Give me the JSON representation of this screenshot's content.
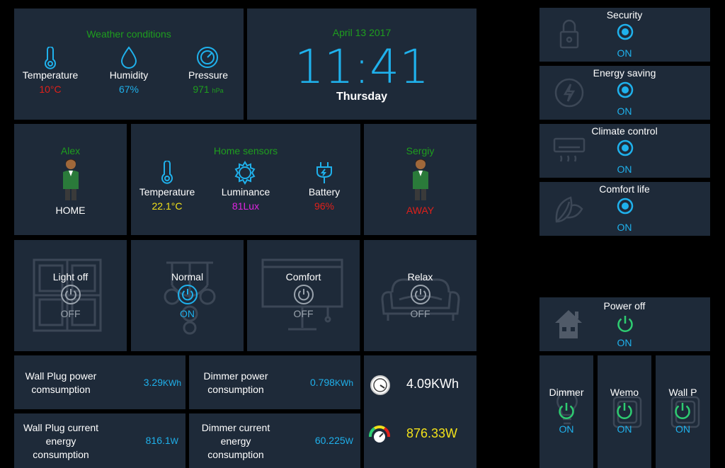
{
  "weather": {
    "title": "Weather conditions",
    "temperature": {
      "label": "Temperature",
      "value": "10°C"
    },
    "humidity": {
      "label": "Humidity",
      "value": "67%"
    },
    "pressure": {
      "label": "Pressure",
      "value": "971",
      "unit": "hPa"
    }
  },
  "clock": {
    "date": "April 13 2017",
    "time": "11:41",
    "day": "Thursday"
  },
  "persons": [
    {
      "name": "Alex",
      "status": "HOME"
    },
    {
      "name": "Sergiy",
      "status": "AWAY"
    }
  ],
  "home_sensors": {
    "title": "Home sensors",
    "temperature": {
      "label": "Temperature",
      "value": "22.1°C"
    },
    "luminance": {
      "label": "Luminance",
      "value": "81Lux"
    },
    "battery": {
      "label": "Battery",
      "value": "96%"
    }
  },
  "scenes": [
    {
      "label": "Light off",
      "state": "OFF"
    },
    {
      "label": "Normal",
      "state": "ON"
    },
    {
      "label": "Comfort",
      "state": "OFF"
    },
    {
      "label": "Relax",
      "state": "OFF"
    }
  ],
  "energy": {
    "wall_plug_power": {
      "label_1": "Wall Plug power",
      "label_2": "comsumption",
      "value": "3.29",
      "unit": "KWh"
    },
    "dimmer_power": {
      "label_1": "Dimmer power",
      "label_2": "consumption",
      "value": "0.798",
      "unit": "KWh"
    },
    "wall_plug_current": {
      "label_1": "Wall Plug current",
      "label_2": "energy",
      "label_3": "consumption",
      "value": "816.1",
      "unit": "W"
    },
    "dimmer_current": {
      "label_1": "Dimmer current",
      "label_2": "energy",
      "label_3": "consumption",
      "value": "60.225",
      "unit": "W"
    },
    "total_kwh": "4.09KWh",
    "total_w": "876.33W"
  },
  "modes": [
    {
      "label": "Security",
      "state": "ON",
      "icon": "lock-icon"
    },
    {
      "label": "Energy saving",
      "state": "ON",
      "icon": "lightning-icon"
    },
    {
      "label": "Climate control",
      "state": "ON",
      "icon": "air-conditioner-icon"
    },
    {
      "label": "Comfort life",
      "state": "ON",
      "icon": "leaf-icon"
    }
  ],
  "power_off": {
    "label": "Power off",
    "state": "ON"
  },
  "devices": [
    {
      "label": "Dimmer",
      "state": "ON"
    },
    {
      "label": "Wemo",
      "state": "ON"
    },
    {
      "label": "Wall P",
      "state": "ON"
    }
  ],
  "colors": {
    "background": "#000000",
    "tile": "#1e2a39",
    "accent_cyan": "#1fb1ec",
    "title_green": "#1e9e1e",
    "power_green": "#2ecc71",
    "alert_red": "#e0201a",
    "sensor_yellow": "#f2e11a",
    "lux_magenta": "#e024e0",
    "muted_icon": "#56606e"
  }
}
